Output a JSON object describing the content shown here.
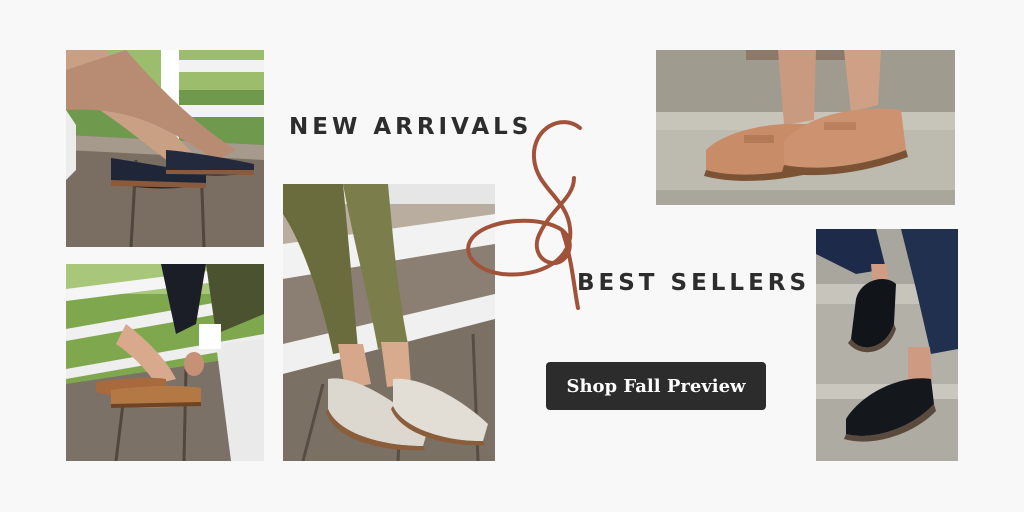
{
  "headline": {
    "line1": "NEW ARRIVALS",
    "line2": "BEST SELLERS"
  },
  "cta": {
    "label": "Shop Fall Preview"
  },
  "colors": {
    "background": "#f8f8f8",
    "text": "#2d2d2d",
    "ampersand_accent": "#a0533a",
    "button_bg": "#2c2c2c",
    "button_text": "#ffffff"
  },
  "photos": [
    {
      "subject": "navy flat shoes on wooden steps"
    },
    {
      "subject": "tan flat shoes on wooden steps"
    },
    {
      "subject": "white slip-on mules with olive pants on steps"
    },
    {
      "subject": "tan penny loafers on stone steps"
    },
    {
      "subject": "black flat shoes with jeans on stone steps"
    }
  ]
}
